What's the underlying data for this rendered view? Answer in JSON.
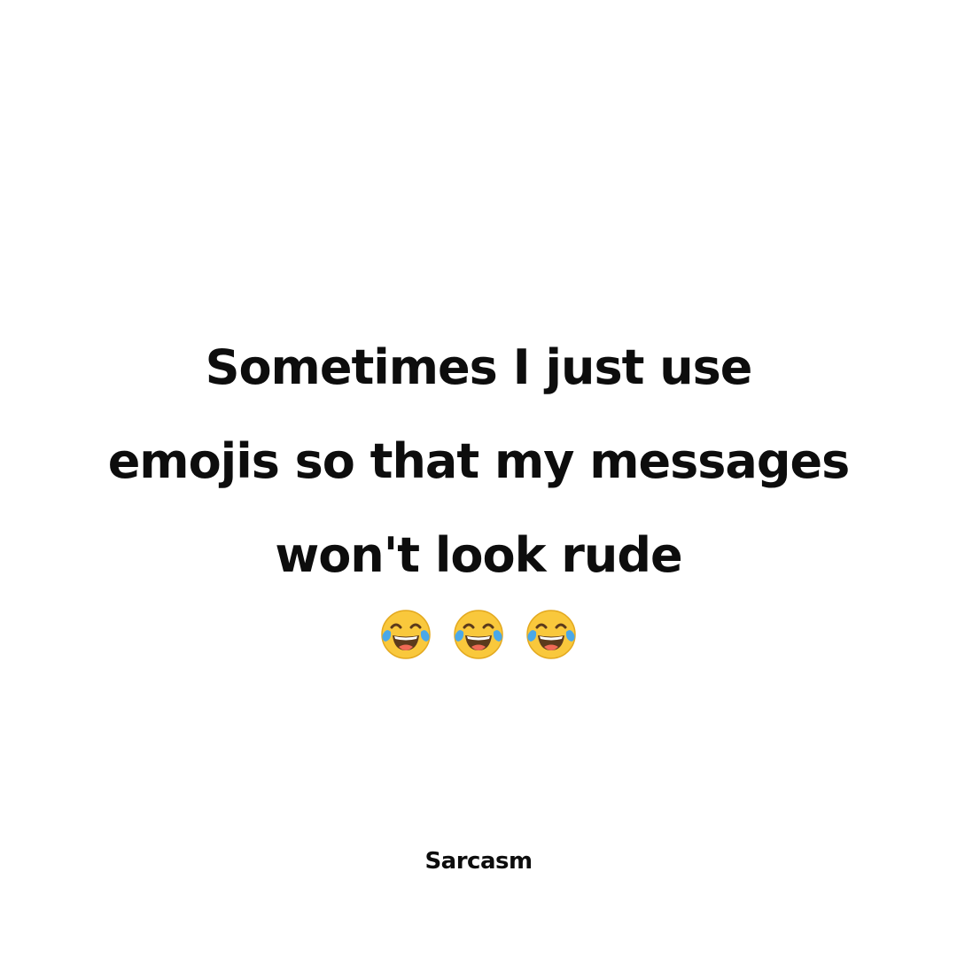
{
  "post": {
    "quote_lines": [
      "Sometimes I just use",
      "emojis so that my messages",
      "won't look rude"
    ],
    "emojis": [
      "face-with-tears-of-joy-icon",
      "face-with-tears-of-joy-icon",
      "face-with-tears-of-joy-icon"
    ],
    "footer": "Sarcasm"
  },
  "colors": {
    "background": "#ffffff",
    "text": "#0d0d0d",
    "emoji_face": "#f9c83c",
    "emoji_tear": "#4aa8e8",
    "emoji_mouth": "#5b3a1c",
    "emoji_tongue": "#f06a55"
  }
}
